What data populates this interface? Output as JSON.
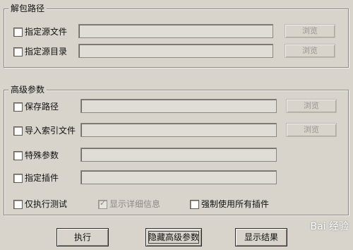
{
  "unpack": {
    "title": "解包路径",
    "rows": [
      {
        "label": "指定源文件",
        "browse": "浏览"
      },
      {
        "label": "指定源目录",
        "browse": "浏览"
      }
    ]
  },
  "advanced": {
    "title": "高级参数",
    "rows": [
      {
        "label": "保存路径",
        "browse": "浏览"
      },
      {
        "label": "导入索引文件",
        "browse": "浏览"
      },
      {
        "label": "特殊参数"
      },
      {
        "label": "指定插件"
      }
    ],
    "options": {
      "test_only": "仅执行测试",
      "show_details": "显示详细信息",
      "force_plugins": "强制使用所有插件"
    }
  },
  "buttons": {
    "run": "执行",
    "hide_advanced": "隐藏高级参数",
    "show_results": "显示结果"
  },
  "watermark": "Bai 经验"
}
